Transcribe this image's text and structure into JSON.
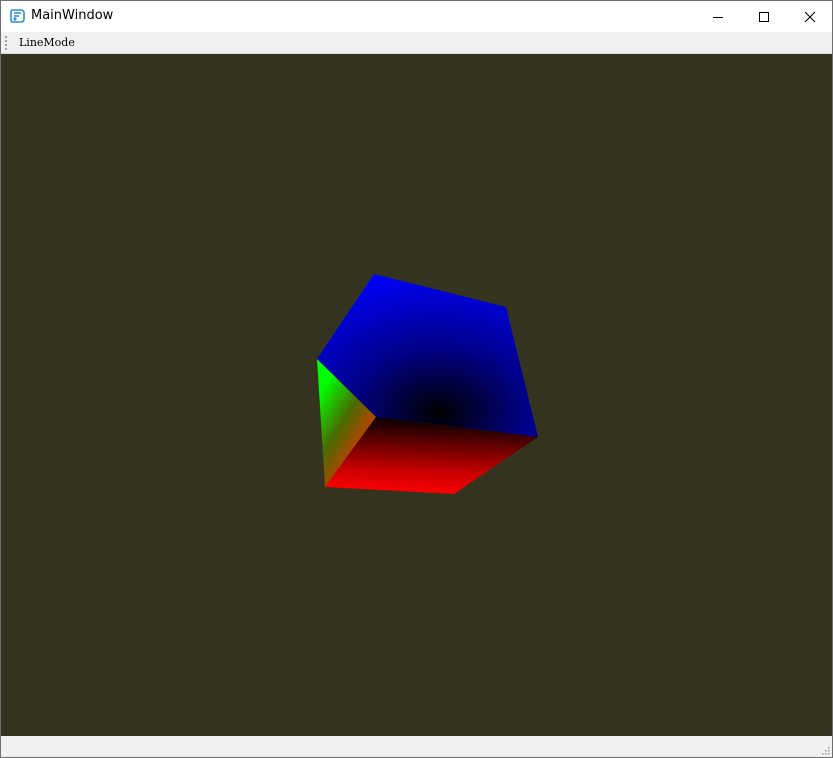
{
  "window": {
    "title": "MainWindow",
    "controls": {
      "minimize_icon": "minimize-icon",
      "maximize_icon": "maximize-icon",
      "close_icon": "close-icon"
    }
  },
  "toolbar": {
    "actions": [
      {
        "label": "LineMode"
      }
    ]
  },
  "viewport": {
    "background_color": "#33331f",
    "scene": "rgb-cube",
    "face_colors": [
      "#00ff00",
      "#0000ff",
      "#ff0000",
      "#000000"
    ]
  },
  "colors": {
    "titlebar_bg": "#ffffff",
    "chrome_bg": "#f0f0f0"
  }
}
